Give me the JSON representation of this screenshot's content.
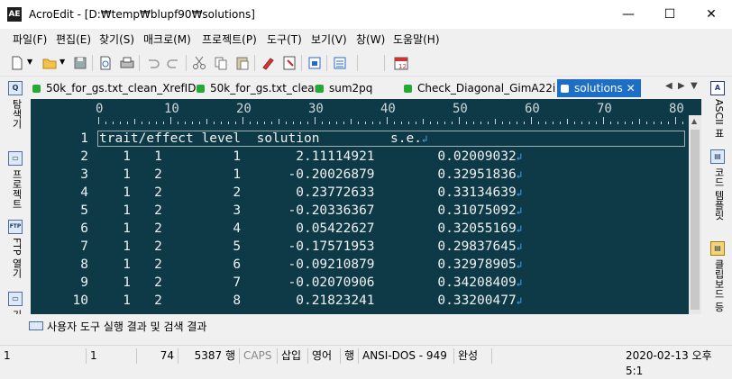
{
  "window": {
    "app_icon": "AE",
    "title": "AcroEdit - [D:₩temp₩blupf90₩solutions]",
    "minimize_icon": "—",
    "maximize_icon": "☐",
    "close_icon": "✕"
  },
  "menu": [
    "파일(F)",
    "편집(E)",
    "찾기(S)",
    "매크로(M)",
    "프로젝트(P)",
    "도구(T)",
    "보기(V)",
    "창(W)",
    "도움말(H)"
  ],
  "tabs": [
    {
      "label": "50k_for_gs.txt_clean_XrefID",
      "active": false
    },
    {
      "label": "50k_for_gs.txt_clean",
      "active": false
    },
    {
      "label": "sum2pq",
      "active": false
    },
    {
      "label": "Check_Diagonal_GimA22i",
      "active": false
    },
    {
      "label": "solutions",
      "active": true
    }
  ],
  "tab_close_icon": "✕",
  "tab_nav": {
    "prev": "◀",
    "next": "▶",
    "list": "▼"
  },
  "left_panel": [
    {
      "icon": "Q",
      "label": "탐색기"
    },
    {
      "icon": "▭",
      "label": "프로젝트"
    },
    {
      "icon": "FTP",
      "label": "FTP 열기"
    },
    {
      "icon": "▭",
      "label": "기"
    }
  ],
  "right_panel": [
    {
      "icon": "A",
      "label": "ASCII 표"
    },
    {
      "icon": "▤",
      "label": "코드 템플릿"
    },
    {
      "icon": "▤",
      "label": "클립보드 등"
    }
  ],
  "ruler": {
    "marks": [
      "0",
      "10",
      "20",
      "30",
      "40",
      "50",
      "60",
      "70",
      "80"
    ]
  },
  "editor": {
    "lines": [
      {
        "n": "1",
        "text": "trait/effect level  solution         s.e."
      },
      {
        "n": "2",
        "text": "   1   1         1       2.11114921        0.02009032"
      },
      {
        "n": "3",
        "text": "   1   2         1      -0.20026879        0.32951836"
      },
      {
        "n": "4",
        "text": "   1   2         2       0.23772633        0.33134639"
      },
      {
        "n": "5",
        "text": "   1   2         3      -0.20336367        0.31075092"
      },
      {
        "n": "6",
        "text": "   1   2         4       0.05422627        0.32055169"
      },
      {
        "n": "7",
        "text": "   1   2         5      -0.17571953        0.29837645"
      },
      {
        "n": "8",
        "text": "   1   2         6      -0.09210879        0.32978905"
      },
      {
        "n": "9",
        "text": "   1   2         7      -0.02070906        0.34208409"
      },
      {
        "n": "10",
        "text": "   1   2         8       0.21823241        0.33200477"
      }
    ],
    "eol_marker": "↲"
  },
  "output_panel": {
    "label": "사용자 도구 실행 결과 및 검색 결과"
  },
  "status": {
    "line": "1",
    "col": "1",
    "chars": "74",
    "total_lines": "5387 행",
    "caps": "CAPS",
    "insert": "삽입",
    "lang": "영어",
    "unit": "행",
    "encoding": "ANSI-DOS - 949",
    "state": "완성",
    "datetime": "2020-02-13 오후 5:1"
  },
  "colors": {
    "editor_bg": "#0e3947",
    "editor_text": "#eef2f2",
    "eol": "#4aa8ff",
    "active_tab": "#1c6ec6",
    "tab_dot": "#22aa33"
  }
}
